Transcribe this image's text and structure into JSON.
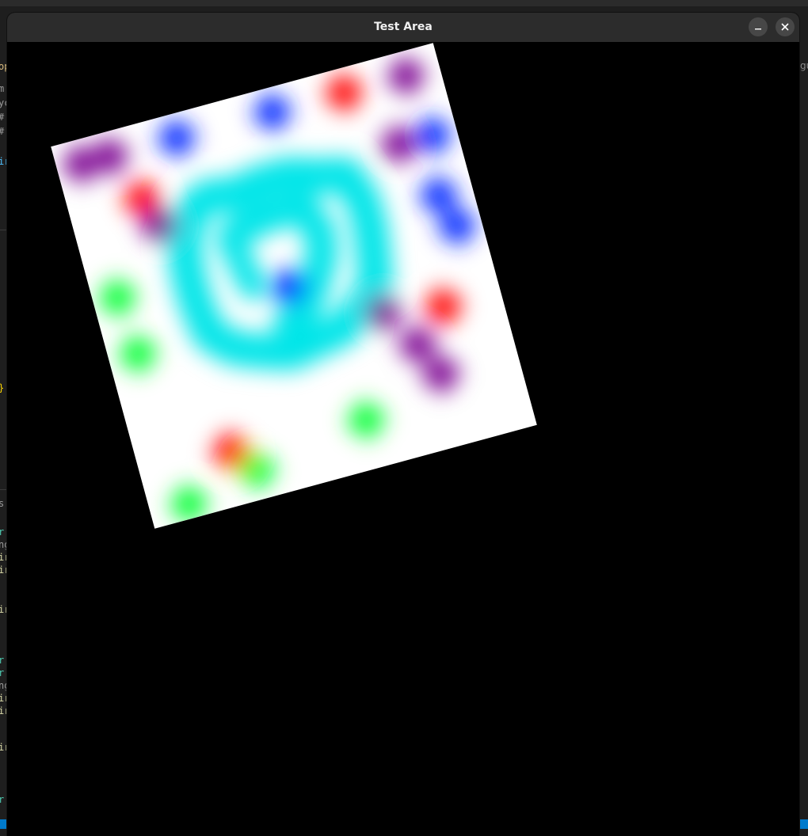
{
  "window": {
    "title": "Test Area",
    "minimize_icon": "minimize-icon",
    "close_icon": "close-icon"
  },
  "background_editor": {
    "right_fragment": "gu",
    "code_fragments": [
      {
        "text": "op",
        "color": "#d7ba7d"
      },
      {
        "text": "m",
        "color": "#9a9a9a"
      },
      {
        "text": "yc",
        "color": "#9a9a9a"
      },
      {
        "text": "#.",
        "color": "#9a9a9a"
      },
      {
        "text": "#.",
        "color": "#9a9a9a"
      },
      {
        "text": "ir",
        "color": "#4fc1ff"
      },
      {
        "text": "}",
        "color": "#ffd700"
      },
      {
        "text": "s",
        "color": "#9a9a9a"
      },
      {
        "text": "r:",
        "color": "#4ec9b0"
      },
      {
        "text": "ng",
        "color": "#9a9a9a"
      },
      {
        "text": "ir",
        "color": "#dcdcaa"
      },
      {
        "text": "ir",
        "color": "#dcdcaa"
      },
      {
        "text": "ir",
        "color": "#dcdcaa"
      },
      {
        "text": "r:",
        "color": "#4ec9b0"
      },
      {
        "text": "r:",
        "color": "#4ec9b0"
      },
      {
        "text": "ng",
        "color": "#9a9a9a"
      },
      {
        "text": "ir",
        "color": "#dcdcaa"
      },
      {
        "text": "ir",
        "color": "#dcdcaa"
      },
      {
        "text": "ir",
        "color": "#dcdcaa"
      },
      {
        "text": "r:",
        "color": "#4ec9b0"
      }
    ]
  },
  "canvas": {
    "grid_size": 8,
    "colors": {
      "background": "#ffffff",
      "cyan": "#00e5e8",
      "blue": "#0028ff",
      "red": "#ff0000",
      "green": "#00ff30",
      "purple": "#7a0090"
    },
    "blobs": [
      {
        "color": "purple",
        "row": 0,
        "col": 0
      },
      {
        "color": "purple",
        "row": 0,
        "col": 0.6
      },
      {
        "color": "blue",
        "row": 0,
        "col": 2
      },
      {
        "color": "blue",
        "row": 0,
        "col": 4
      },
      {
        "color": "red",
        "row": 0,
        "col": 5.5
      },
      {
        "color": "purple",
        "row": 0,
        "col": 6.8
      },
      {
        "color": "red",
        "row": 1,
        "col": 1
      },
      {
        "color": "purple",
        "row": 1.6,
        "col": 1.2
      },
      {
        "color": "purple",
        "row": 1.3,
        "col": 6.3
      },
      {
        "color": "blue",
        "row": 1.3,
        "col": 7
      },
      {
        "color": "blue",
        "row": 2.5,
        "col": 6.8
      },
      {
        "color": "blue",
        "row": 3.2,
        "col": 7
      },
      {
        "color": "green",
        "row": 2.8,
        "col": 0
      },
      {
        "color": "green",
        "row": 4,
        "col": 0.1
      },
      {
        "color": "blue",
        "row": 3.5,
        "col": 3.4
      },
      {
        "color": "purple",
        "row": 4.5,
        "col": 5.1
      },
      {
        "color": "purple",
        "row": 5.3,
        "col": 5.6
      },
      {
        "color": "purple",
        "row": 6.0,
        "col": 5.9
      },
      {
        "color": "red",
        "row": 4.7,
        "col": 6.3
      },
      {
        "color": "red",
        "row": 6.4,
        "col": 1.4
      },
      {
        "color": "green",
        "row": 7.2,
        "col": 0.3
      },
      {
        "color": "green",
        "row": 6.9,
        "col": 1.8
      },
      {
        "color": "green",
        "row": 6.5,
        "col": 4.2
      }
    ],
    "cyan_path": [
      [
        2.3,
        1.3
      ],
      [
        2.8,
        1.4
      ],
      [
        3.4,
        1.3
      ],
      [
        4.0,
        1.3
      ],
      [
        4.6,
        1.5
      ],
      [
        5.1,
        1.6
      ],
      [
        5.3,
        2.2
      ],
      [
        5.3,
        2.8
      ],
      [
        5.2,
        3.4
      ],
      [
        5.1,
        3.9
      ],
      [
        4.7,
        4.3
      ],
      [
        4.2,
        4.6
      ],
      [
        3.6,
        4.7
      ],
      [
        3.1,
        4.8
      ],
      [
        2.5,
        4.6
      ],
      [
        2.0,
        4.4
      ],
      [
        1.6,
        4.0
      ],
      [
        1.5,
        3.3
      ],
      [
        1.5,
        2.7
      ],
      [
        1.6,
        2.0
      ],
      [
        1.9,
        1.5
      ],
      [
        2.3,
        1.3
      ]
    ],
    "cyan_inner": [
      [
        2.8,
        2.1
      ],
      [
        3.4,
        2.0
      ],
      [
        4.1,
        2.0
      ],
      [
        4.3,
        2.6
      ],
      [
        4.2,
        3.1
      ],
      [
        3.9,
        3.6
      ],
      [
        3.6,
        4.0
      ],
      [
        3.2,
        4.2
      ]
    ],
    "cyan_spur": [
      [
        2.5,
        2.2
      ],
      [
        2.6,
        2.8
      ],
      [
        2.7,
        3.3
      ]
    ]
  }
}
